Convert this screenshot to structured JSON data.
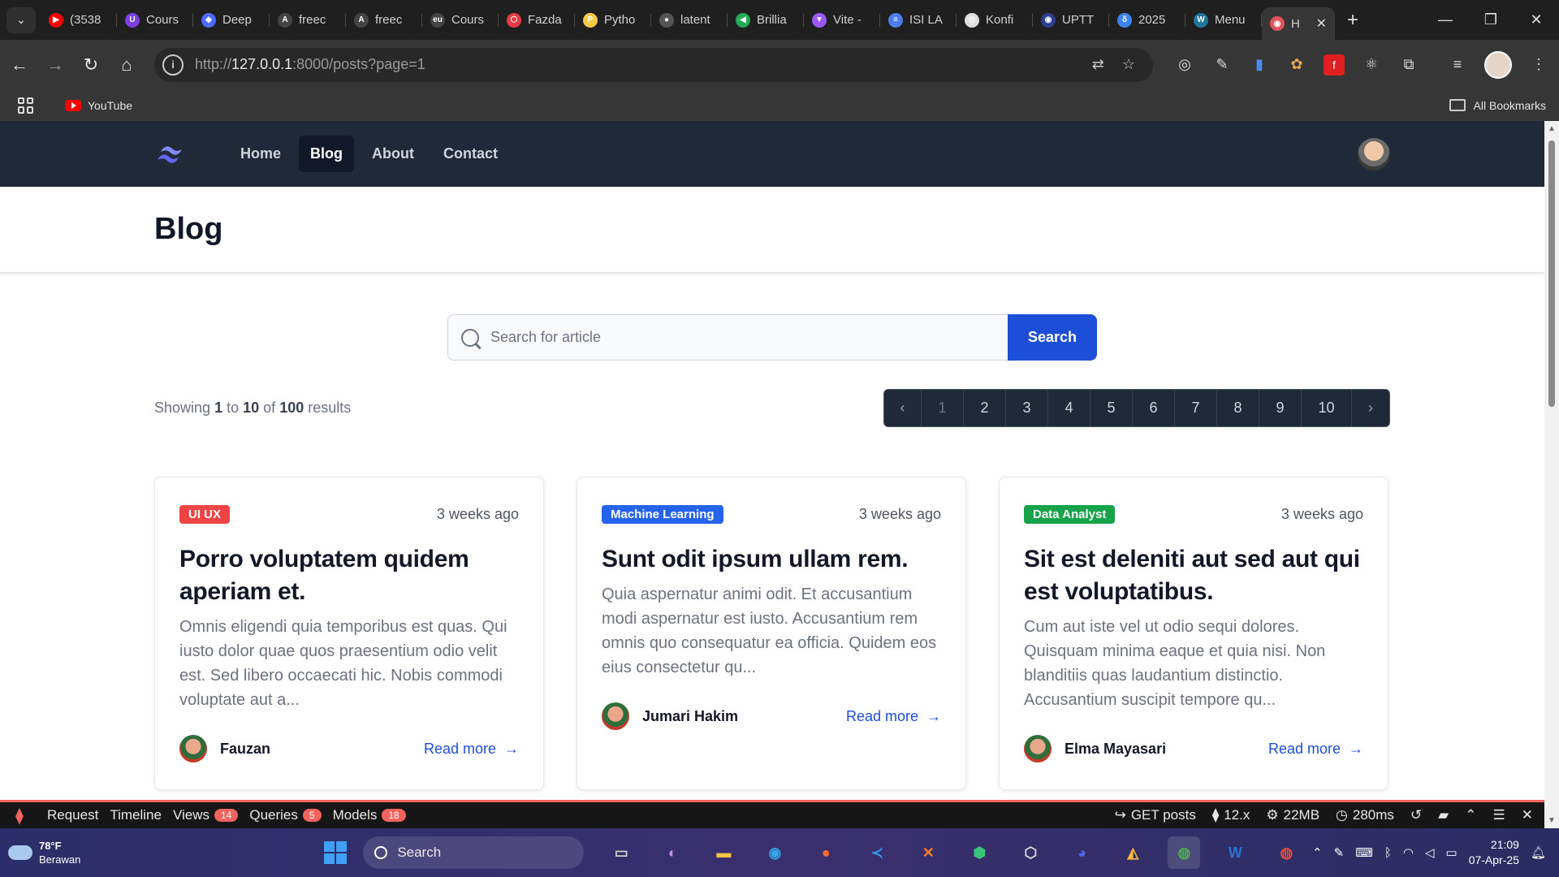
{
  "browser": {
    "tabs": [
      {
        "label": "(3538",
        "color": "#ff0000",
        "glyph": "▶"
      },
      {
        "label": "Cours",
        "color": "#7b3fe4",
        "glyph": "U"
      },
      {
        "label": "Deep",
        "color": "#4d6bfe",
        "glyph": "◆"
      },
      {
        "label": "freec",
        "color": "#444444",
        "glyph": "A"
      },
      {
        "label": "freec",
        "color": "#444444",
        "glyph": "A"
      },
      {
        "label": "Cours",
        "color": "#444444",
        "glyph": "eu"
      },
      {
        "label": "Fazda",
        "color": "#e63946",
        "glyph": "⬡"
      },
      {
        "label": "Pytho",
        "color": "#f7c948",
        "glyph": "P"
      },
      {
        "label": "latent",
        "color": "#555555",
        "glyph": "●"
      },
      {
        "label": "Brillia",
        "color": "#22aa55",
        "glyph": "◀"
      },
      {
        "label": "Vite -",
        "color": "#9b59f6",
        "glyph": "▼"
      },
      {
        "label": "ISI LA",
        "color": "#4a7de8",
        "glyph": "≡"
      },
      {
        "label": "Konfi",
        "color": "#dddddd",
        "glyph": "◎"
      },
      {
        "label": "UPTT",
        "color": "#2c3e90",
        "glyph": "◉"
      },
      {
        "label": "2025",
        "color": "#3b82f6",
        "glyph": "δ"
      },
      {
        "label": "Menu",
        "color": "#21759b",
        "glyph": "W"
      }
    ],
    "active_tab": {
      "label": "H",
      "color": "#e0525a",
      "glyph": "◉"
    },
    "url_prefix": "http://",
    "url_host": "127.0.0.1",
    "url_rest": ":8000/posts?page=1",
    "bookmarks": {
      "youtube": "YouTube",
      "all": "All Bookmarks"
    }
  },
  "site": {
    "nav": [
      {
        "label": "Home",
        "active": false
      },
      {
        "label": "Blog",
        "active": true
      },
      {
        "label": "About",
        "active": false
      },
      {
        "label": "Contact",
        "active": false
      }
    ],
    "page_title": "Blog",
    "search": {
      "placeholder": "Search for article",
      "button": "Search"
    },
    "results": {
      "prefix": "Showing",
      "from": "1",
      "to_word": "to",
      "to": "10",
      "of_word": "of",
      "total": "100",
      "suffix": "results"
    },
    "pagination": {
      "current": 1,
      "pages": [
        "1",
        "2",
        "3",
        "4",
        "5",
        "6",
        "7",
        "8",
        "9",
        "10"
      ]
    },
    "posts": [
      {
        "category": "UI UX",
        "category_color": "#ef4444",
        "time": "3 weeks ago",
        "title": "Porro voluptatem quidem aperiam et.",
        "excerpt": "Omnis eligendi quia temporibus est quas. Qui iusto dolor quae quos praesentium odio velit est. Sed libero occaecati hic. Nobis commodi voluptate aut a...",
        "author": "Fauzan",
        "read_more": "Read more"
      },
      {
        "category": "Machine Learning",
        "category_color": "#2563eb",
        "time": "3 weeks ago",
        "title": "Sunt odit ipsum ullam rem.",
        "excerpt": "Quia aspernatur animi odit. Et accusantium modi aspernatur est iusto. Accusantium rem omnis quo consequatur ea officia. Quidem eos eius consectetur qu...",
        "author": "Jumari Hakim",
        "read_more": "Read more"
      },
      {
        "category": "Data Analyst",
        "category_color": "#16a34a",
        "time": "3 weeks ago",
        "title": "Sit est deleniti aut sed aut qui est voluptatibus.",
        "excerpt": "Cum aut iste vel ut odio sequi dolores. Quisquam minima eaque et quia nisi. Non blanditiis quas laudantium distinctio. Accusantium suscipit tempore qu...",
        "author": "Elma Mayasari",
        "read_more": "Read more"
      }
    ]
  },
  "debugbar": {
    "tabs": [
      {
        "label": "Request",
        "count": null
      },
      {
        "label": "Timeline",
        "count": null
      },
      {
        "label": "Views",
        "count": "14"
      },
      {
        "label": "Queries",
        "count": "5"
      },
      {
        "label": "Models",
        "count": "18"
      }
    ],
    "route": "GET posts",
    "version": "12.x",
    "memory": "22MB",
    "duration": "280ms"
  },
  "taskbar": {
    "temperature": "78°F",
    "condition": "Berawan",
    "search": "Search",
    "time": "21:09",
    "date": "07-Apr-25"
  }
}
